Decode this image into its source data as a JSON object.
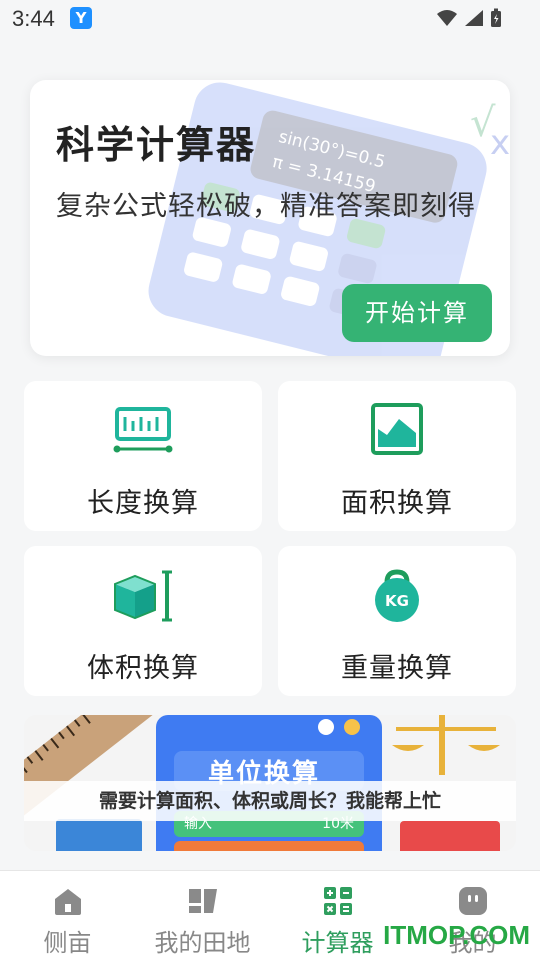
{
  "status_bar": {
    "time": "3:44",
    "app_badge": "Y"
  },
  "hero": {
    "title": "科学计算器",
    "subtitle": "复杂公式轻松破，精准答案即刻得",
    "start_button": "开始计算",
    "illustration_text_1": "sin(30°)=0.5",
    "illustration_text_2": "π = 3.14159"
  },
  "tools": [
    {
      "label": "长度换算",
      "icon": "ruler-icon"
    },
    {
      "label": "面积换算",
      "icon": "area-icon"
    },
    {
      "label": "体积换算",
      "icon": "cube-icon"
    },
    {
      "label": "重量换算",
      "icon": "kg-weight-icon"
    }
  ],
  "kg_text": "KG",
  "banner": {
    "board_title": "单位换算",
    "board_row_left": "输入",
    "board_row_right": "10米",
    "caption": "需要计算面积、体积或周长？我能帮上忙"
  },
  "bottom_nav": {
    "items": [
      {
        "label": "侧亩",
        "icon": "home-icon"
      },
      {
        "label": "我的田地",
        "icon": "field-icon"
      },
      {
        "label": "计算器",
        "icon": "calculator-icon"
      },
      {
        "label": "我的",
        "icon": "profile-icon"
      }
    ],
    "active_index": 2
  },
  "watermark": "ITMOP.COM",
  "colors": {
    "accent_green": "#35b374",
    "icon_teal": "#1fb59c",
    "background": "#f5f6f7"
  }
}
